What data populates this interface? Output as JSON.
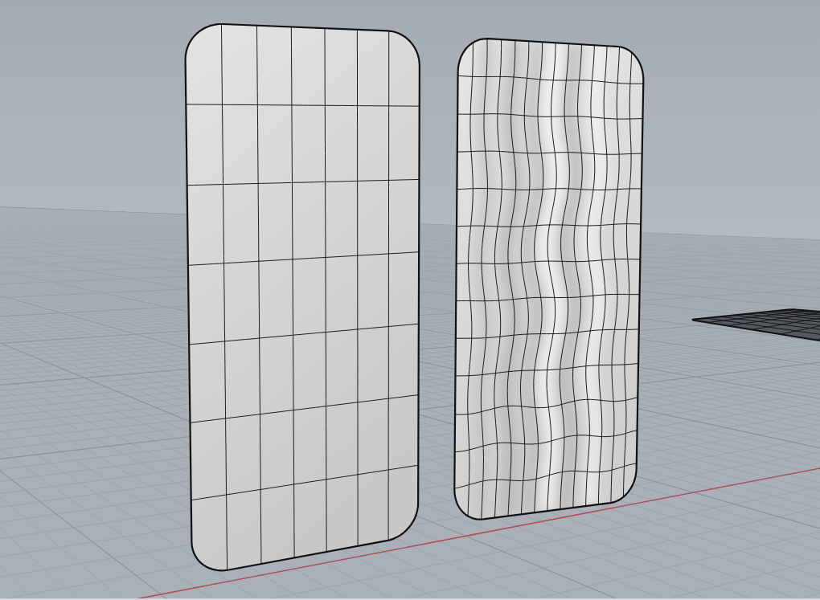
{
  "viewport": {
    "construction_plane": {
      "grid": true,
      "x_axis": true
    },
    "objects": [
      {
        "kind": "flat-panel"
      },
      {
        "kind": "wavy-panel"
      },
      {
        "kind": "grid-patch"
      }
    ]
  }
}
